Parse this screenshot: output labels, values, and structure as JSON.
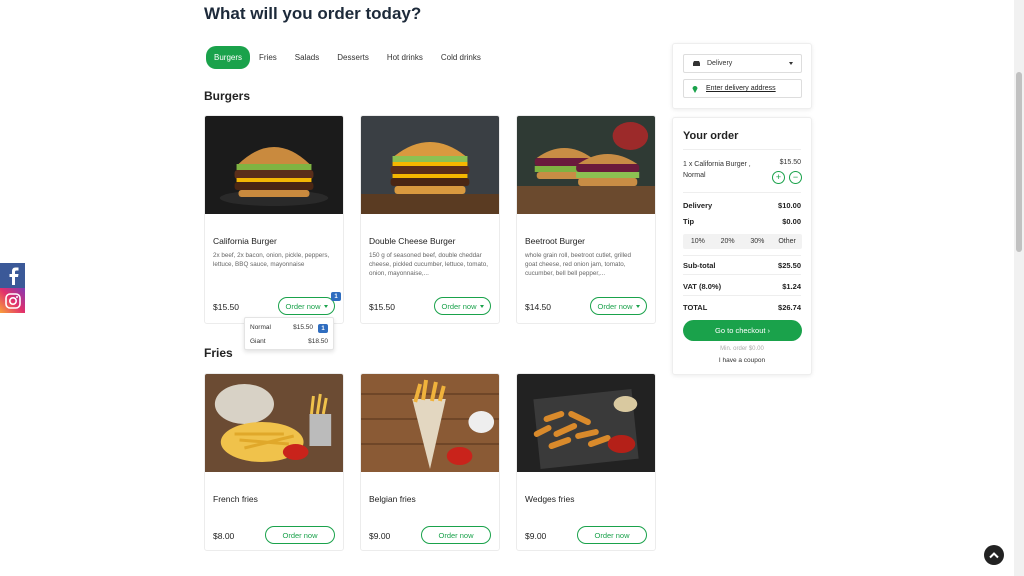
{
  "page": {
    "title": "What will you order today?"
  },
  "tabs": [
    "Burgers",
    "Fries",
    "Salads",
    "Desserts",
    "Hot drinks",
    "Cold drinks"
  ],
  "sections": {
    "burgers": "Burgers",
    "fries": "Fries"
  },
  "burgers": [
    {
      "name": "California Burger",
      "desc": "2x beef, 2x bacon, onion, pickle, peppers, lettuce, BBQ sauce, mayonnaise",
      "price": "$15.50",
      "button": "Order now",
      "badge": "1"
    },
    {
      "name": "Double Cheese Burger",
      "desc": "150 g of seasoned beef, double cheddar cheese, pickled cucumber, lettuce, tomato, onion, mayonnaise,...",
      "price": "$15.50",
      "button": "Order now"
    },
    {
      "name": "Beetroot Burger",
      "desc": "whole grain roll, beetroot cutlet, grilled goat cheese, red onion jam, tomato, cucumber, bell bell pepper,...",
      "price": "$14.50",
      "button": "Order now"
    }
  ],
  "size_dropdown": [
    {
      "label": "Normal",
      "price": "$15.50",
      "badge": "1"
    },
    {
      "label": "Giant",
      "price": "$18.50"
    }
  ],
  "fries": [
    {
      "name": "French fries",
      "price": "$8.00",
      "button": "Order now"
    },
    {
      "name": "Belgian fries",
      "price": "$9.00",
      "button": "Order now"
    },
    {
      "name": "Wedges fries",
      "price": "$9.00",
      "button": "Order now"
    }
  ],
  "delivery": {
    "mode": "Delivery",
    "address_link": "Enter delivery address"
  },
  "order": {
    "title": "Your order",
    "item": {
      "line1": "1 x California Burger ,",
      "line2": "Normal",
      "price": "$15.50"
    },
    "delivery_label": "Delivery",
    "delivery_value": "$10.00",
    "tip_label": "Tip",
    "tip_value": "$0.00",
    "tips": [
      "10%",
      "20%",
      "30%",
      "Other"
    ],
    "subtotal_label": "Sub-total",
    "subtotal_value": "$25.50",
    "vat_label": "VAT (8.0%)",
    "vat_value": "$1.24",
    "total_label": "TOTAL",
    "total_value": "$26.74",
    "checkout": "Go to checkout",
    "min_order": "Min. order $0.00",
    "coupon": "I have a coupon"
  },
  "colors": {
    "accent": "#1aa24b",
    "badge": "#2f6dbf",
    "facebook": "#3b5998"
  },
  "icons": [
    "car-icon",
    "caret-down-icon",
    "map-pin-icon",
    "plus-icon",
    "minus-icon",
    "facebook-icon",
    "instagram-icon",
    "arrow-up-icon"
  ]
}
